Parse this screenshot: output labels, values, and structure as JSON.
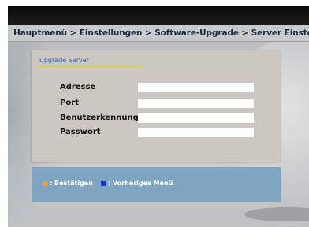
{
  "breadcrumb": "Hauptmenü > Einstellungen > Software-Upgrade > Server Einstellungen",
  "panel": {
    "title": "Upgrade Server",
    "fields": [
      {
        "label": "Adresse",
        "value": ""
      },
      {
        "label": "Port",
        "value": ""
      },
      {
        "label": "Benutzerkennung",
        "value": ""
      },
      {
        "label": "Passwort",
        "value": ""
      }
    ]
  },
  "help": {
    "confirm_label": ": Bestätigen",
    "confirm_color": "#f2a12a",
    "back_label": ": Vorheriges Menü",
    "back_color": "#1a37d6"
  }
}
